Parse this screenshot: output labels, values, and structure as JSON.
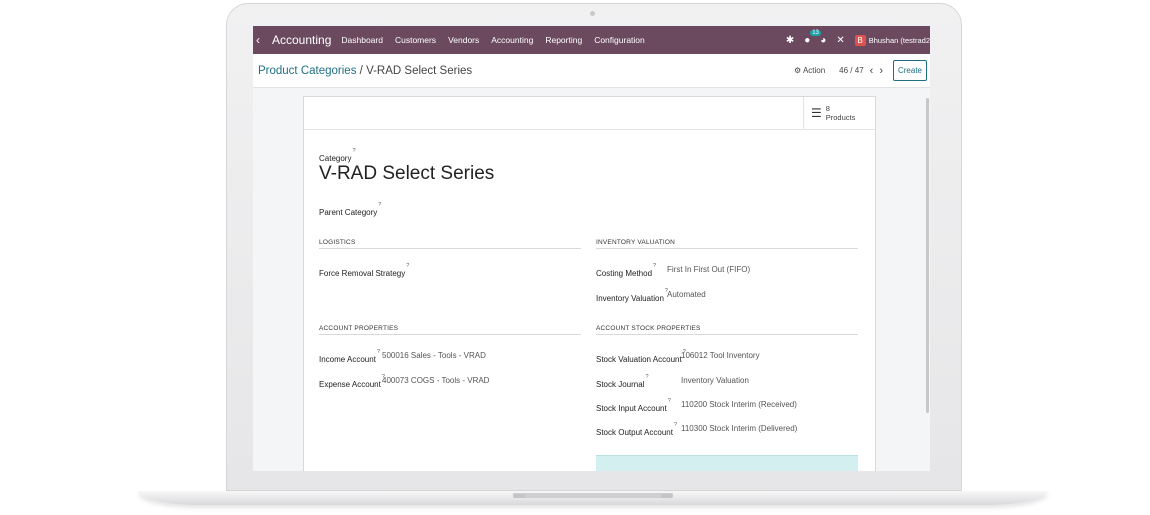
{
  "topbar": {
    "apps_icon": "grid-icon",
    "app_name": "Accounting",
    "menus": [
      "Dashboard",
      "Customers",
      "Vendors",
      "Accounting",
      "Reporting",
      "Configuration"
    ],
    "chat_badge": "13",
    "avatar_initial": "B",
    "user_name": "Bhushan (testrad2"
  },
  "breadcrumb": {
    "parent": "Product Categories",
    "separator": "/",
    "current": "V-RAD Select Series"
  },
  "control": {
    "action_label": "Action",
    "pager": "46 / 47",
    "prev": "‹",
    "next": "›",
    "create_label": "Create"
  },
  "smart_button": {
    "count": "8",
    "label": "Products"
  },
  "form": {
    "category_label": "Category",
    "category_name": "V-RAD Select Series",
    "parent_category_label": "Parent Category",
    "help_mark": "?",
    "logistics": {
      "title": "LOGISTICS",
      "force_removal_label": "Force Removal Strategy"
    },
    "inventory_valuation": {
      "title": "INVENTORY VALUATION",
      "costing_method_label": "Costing Method",
      "costing_method_value": "First In First Out (FIFO)",
      "valuation_label": "Inventory Valuation",
      "valuation_value": "Automated"
    },
    "account_properties": {
      "title": "ACCOUNT PROPERTIES",
      "income_label": "Income Account",
      "income_value": "500016 Sales - Tools - VRAD",
      "expense_label": "Expense Account",
      "expense_value": "400073 COGS - Tools - VRAD"
    },
    "account_stock": {
      "title": "ACCOUNT STOCK PROPERTIES",
      "valuation_account_label": "Stock Valuation Account",
      "valuation_account_value": "106012 Tool Inventory",
      "journal_label": "Stock Journal",
      "journal_value": "Inventory Valuation",
      "input_label": "Stock Input Account",
      "input_value": "110200 Stock Interim (Received)",
      "output_label": "Stock Output Account",
      "output_value": "110300 Stock Interim (Delivered)"
    }
  }
}
